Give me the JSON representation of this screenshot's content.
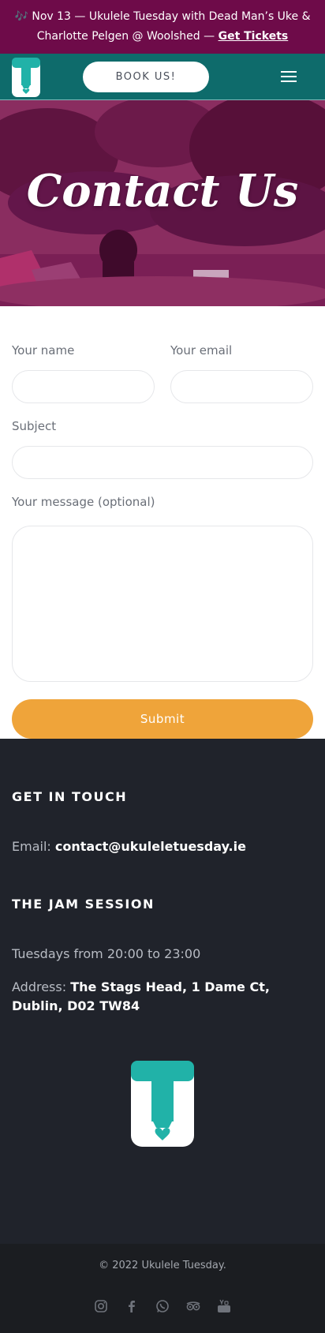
{
  "announcement": {
    "prefix": "🎶 Nov 13 — Ukulele Tuesday with Dead Man’s Uke & Charlotte Pelgen @ Woolshed — ",
    "link": "Get Tickets"
  },
  "header": {
    "book_label": "BOOK US!",
    "menu_icon": "hamburger-menu-icon",
    "logo_icon": "ukulele-tuesday-logo"
  },
  "hero": {
    "title": "Contact Us"
  },
  "form": {
    "name_label": "Your name",
    "email_label": "Your email",
    "subject_label": "Subject",
    "message_label": "Your message (optional)",
    "name_value": "",
    "email_value": "",
    "subject_value": "",
    "message_value": "",
    "submit_label": "Submit"
  },
  "footer": {
    "contact_heading": "GET IN TOUCH",
    "email_label": "Email: ",
    "email_value": "contact@ukuleletuesday.ie",
    "jam_heading": "THE JAM SESSION",
    "schedule": "Tuesdays from 20:00 to 23:00",
    "address_label": "Address: ",
    "address_value": "The Stags Head, 1 Dame Ct, Dublin, D02 TW84"
  },
  "bottom": {
    "copyright": "© 2022 Ukulele Tuesday.",
    "socials": [
      "instagram-icon",
      "facebook-icon",
      "whatsapp-icon",
      "tripadvisor-icon",
      "youtube-icon"
    ]
  },
  "colors": {
    "announce_bg": "#6e0b49",
    "header_bg": "#0e6b6b",
    "teal": "#21b2a8",
    "submit": "#efa43a",
    "footer_bg": "#20232b",
    "bottom_bg": "#1b1d21"
  }
}
